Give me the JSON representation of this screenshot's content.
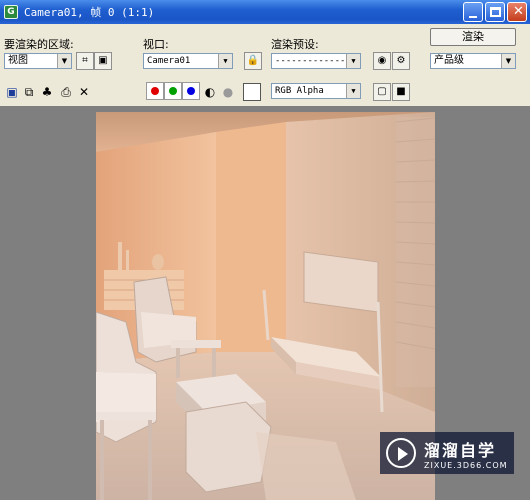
{
  "window": {
    "title": "Camera01, 帧 0 (1:1)",
    "app_icon": "3dsmax-icon",
    "controls": [
      "minimize-icon",
      "maximize-icon",
      "close-icon"
    ]
  },
  "panel": {
    "area_label": "要渲染的区域:",
    "area_value": "视图",
    "viewport_label": "视口:",
    "viewport_value": "Camera01",
    "preset_label": "渲染预设:",
    "preset_value": "--------------------",
    "render_button": "渲染",
    "quality_value": "产品级",
    "channel_value": "RGB Alpha"
  },
  "toolbar_icons": [
    "save-icon",
    "copy-icon",
    "clone-icon",
    "print-icon",
    "clear-icon"
  ],
  "channels": {
    "red": "#e00000",
    "green": "#00a000",
    "blue": "#0000e0"
  },
  "watermark": {
    "name": "溜溜自学",
    "url": "ZIXUE.3D66.COM"
  }
}
